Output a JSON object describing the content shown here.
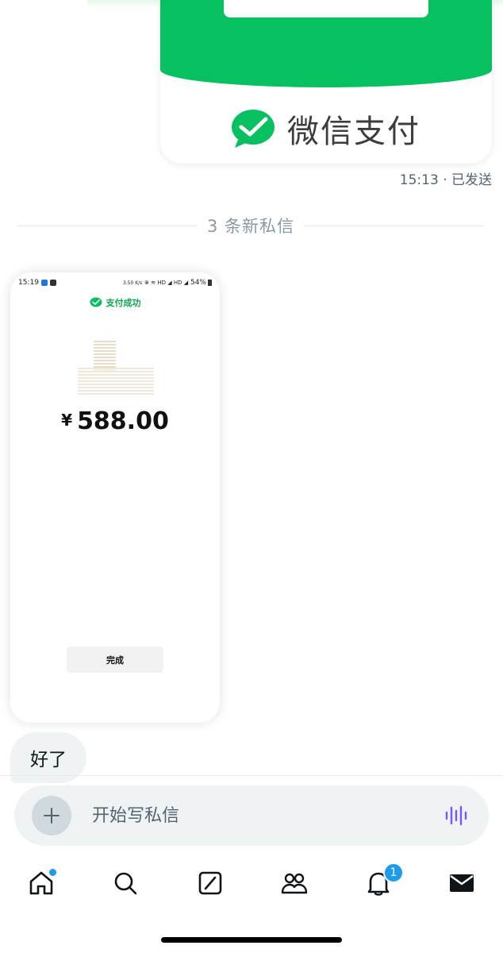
{
  "sent_message": {
    "wechat_pay_label": "微信支付",
    "meta": "15:13 · 已发送"
  },
  "divider": {
    "label": "3 条新私信"
  },
  "received_screenshot": {
    "status_time": "15:19",
    "status_speed": "3.50 K/s",
    "status_battery": "54%",
    "success_label": "支付成功",
    "amount": "588.00",
    "currency_symbol": "¥",
    "done_button": "完成"
  },
  "received_text": {
    "text": "好了"
  },
  "composer": {
    "placeholder": "开始写私信"
  },
  "nav": {
    "items": [
      "home-icon",
      "search-icon",
      "grok-icon",
      "communities-icon",
      "notifications-icon",
      "messages-icon"
    ],
    "notifications_count": "1"
  },
  "colors": {
    "wechat_green": "#07c160",
    "accent_blue": "#1d9bf0",
    "voice_purple": "#7856ff"
  }
}
